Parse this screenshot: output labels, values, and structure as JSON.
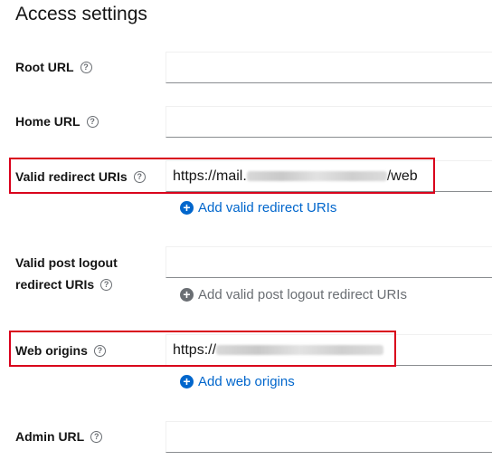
{
  "section_title": "Access settings",
  "fields": {
    "root_url": {
      "label": "Root URL",
      "value": ""
    },
    "home_url": {
      "label": "Home URL",
      "value": ""
    },
    "valid_redirect": {
      "label": "Valid redirect URIs",
      "value_prefix": "https://mail.",
      "value_suffix": "/web",
      "add_label": "Add valid redirect URIs"
    },
    "post_logout": {
      "label_line1": "Valid post logout",
      "label_line2": "redirect URIs",
      "value": "",
      "add_label": "Add valid post logout redirect URIs"
    },
    "web_origins": {
      "label": "Web origins",
      "value_prefix": "https://",
      "add_label": "Add web origins"
    },
    "admin_url": {
      "label": "Admin URL",
      "value": ""
    }
  },
  "help_icon_glyph": "?",
  "add_icon_glyph": "+",
  "highlight_color": "#d9001b",
  "link_color": "#0066cc"
}
